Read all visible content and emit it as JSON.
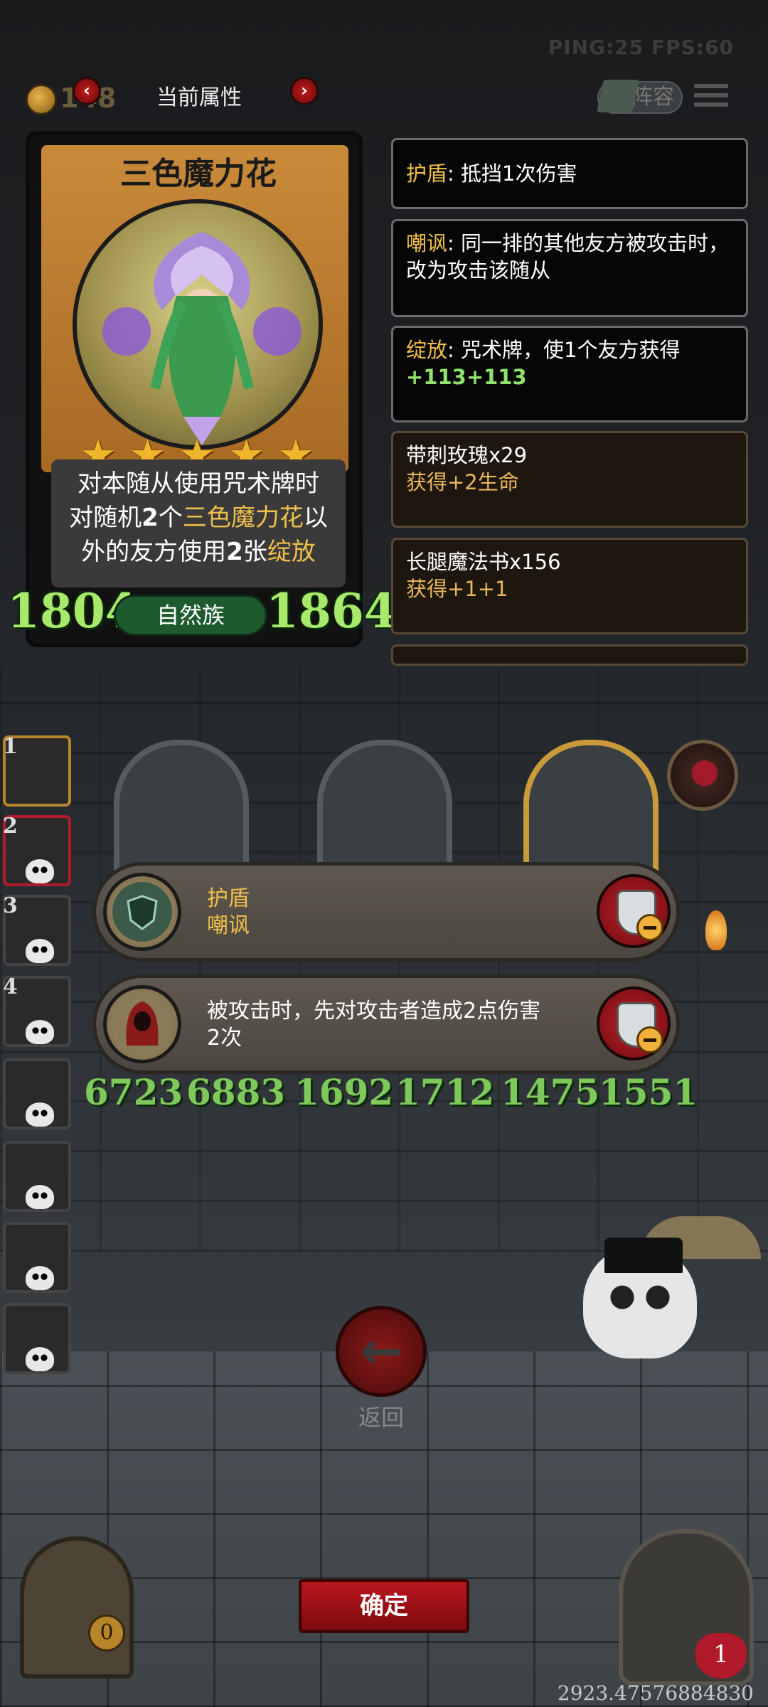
{
  "status": {
    "ping_fps": "PING:25   FPS:60"
  },
  "header": {
    "coins": "148",
    "title": "当前属性",
    "prev_icon": "chevron-left-icon",
    "next_icon": "chevron-right-icon",
    "lineup_label": "阵容",
    "menu_icon": "menu-icon"
  },
  "card": {
    "name": "三色魔力花",
    "stars": 5,
    "desc_line1": "对本随从使用咒术牌时",
    "desc_line2_a": "对随机",
    "desc_line2_b": "2",
    "desc_line2_c": "个",
    "desc_line2_d": "三色魔力花",
    "desc_line2_e": "以",
    "desc_line3_a": "外的友方使用",
    "desc_line3_b": "2",
    "desc_line3_c": "张",
    "desc_line3_d": "绽放",
    "attack": "1804",
    "tribe": "自然族",
    "health": "1864"
  },
  "abilities": [
    {
      "keyword": "护盾",
      "text": ": 抵挡1次伤害"
    },
    {
      "keyword": "嘲讽",
      "text": ": 同一排的其他友方被攻击时，改为攻击该随从"
    },
    {
      "keyword": "绽放",
      "text": ": 咒术牌，使1个友方获得",
      "bonus": "+113+113"
    }
  ],
  "items": [
    {
      "name": "带刺玫瑰x29",
      "effect": "获得+2生命"
    },
    {
      "name": "长腿魔法书x156",
      "effect": "获得+1+1"
    }
  ],
  "lineup": {
    "slots": [
      "1",
      "2",
      "3",
      "4"
    ],
    "selected_slot": "2"
  },
  "board": {
    "stats": [
      "6723",
      "6883",
      "1692",
      "1712",
      "1475",
      "1551"
    ]
  },
  "effects": [
    {
      "line1": "护盾",
      "line2": "嘲讽",
      "icon": "shield-crest-icon"
    },
    {
      "line1": "被攻击时，先对攻击者造成2点伤害",
      "line2": "2次",
      "icon": "hooded-figure-icon"
    }
  ],
  "footer": {
    "back_label": "返回",
    "confirm_label": "确定",
    "gate_count": "0",
    "hero_health": "1",
    "coords": "2923.47576884830"
  },
  "colors": {
    "keyword": "#f0c04a",
    "stat_green": "#a8e86a",
    "button_red": "#b8161c"
  }
}
